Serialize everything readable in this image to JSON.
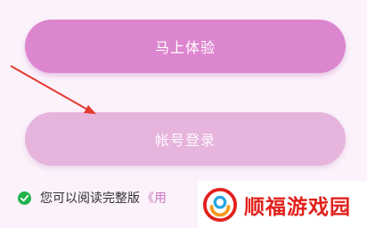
{
  "buttons": {
    "try_now_label": "马上体验",
    "account_login_label": "帐号登录"
  },
  "agreement": {
    "text": "您可以阅读完整版",
    "link_text": "《用"
  },
  "watermark": {
    "text": "顺福游戏园"
  },
  "icons": {
    "check": "check-circle-icon",
    "arrow": "annotation-arrow-icon",
    "logo": "watermark-logo-icon"
  },
  "colors": {
    "primary_button": "#dd86d0",
    "secondary_button": "#e6b4dc",
    "check_green": "#22b24c",
    "arrow_red": "#e43a2f",
    "watermark_red": "#e2211c"
  }
}
